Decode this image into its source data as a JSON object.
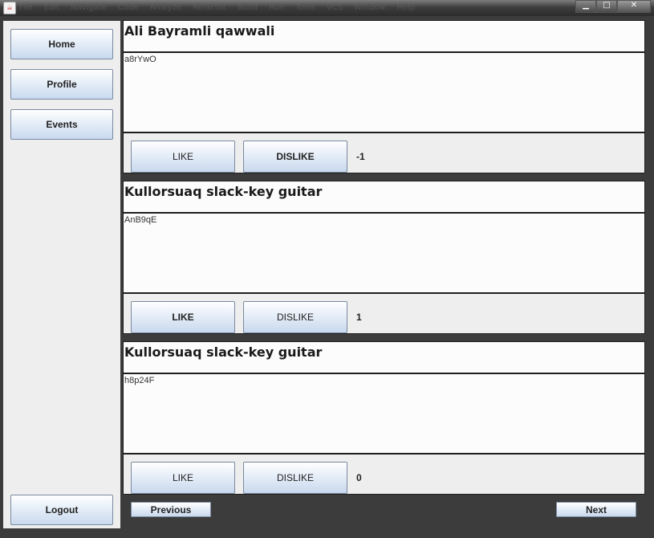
{
  "window": {
    "menu": [
      "File",
      "Edit",
      "Navigate",
      "Code",
      "Analyze",
      "Refactor",
      "Build",
      "Run",
      "Tools",
      "VCS",
      "Window",
      "Help"
    ],
    "controls": {
      "minimize": "▁",
      "maximize": "□",
      "close": "✕"
    }
  },
  "sidebar": {
    "home_label": "Home",
    "profile_label": "Profile",
    "events_label": "Events",
    "logout_label": "Logout"
  },
  "posts": [
    {
      "title": "Ali Bayramli qawwali",
      "body": "a8rYwO",
      "like_label": "LIKE",
      "dislike_label": "DISLIKE",
      "score": "-1"
    },
    {
      "title": "Kullorsuaq slack-key guitar",
      "body": "AnB9qE",
      "like_label": "LIKE",
      "dislike_label": "DISLIKE",
      "score": "1"
    },
    {
      "title": "Kullorsuaq slack-key guitar",
      "body": "h8p24F",
      "like_label": "LIKE",
      "dislike_label": "DISLIKE",
      "score": "0"
    }
  ],
  "pagination": {
    "previous_label": "Previous",
    "next_label": "Next"
  }
}
